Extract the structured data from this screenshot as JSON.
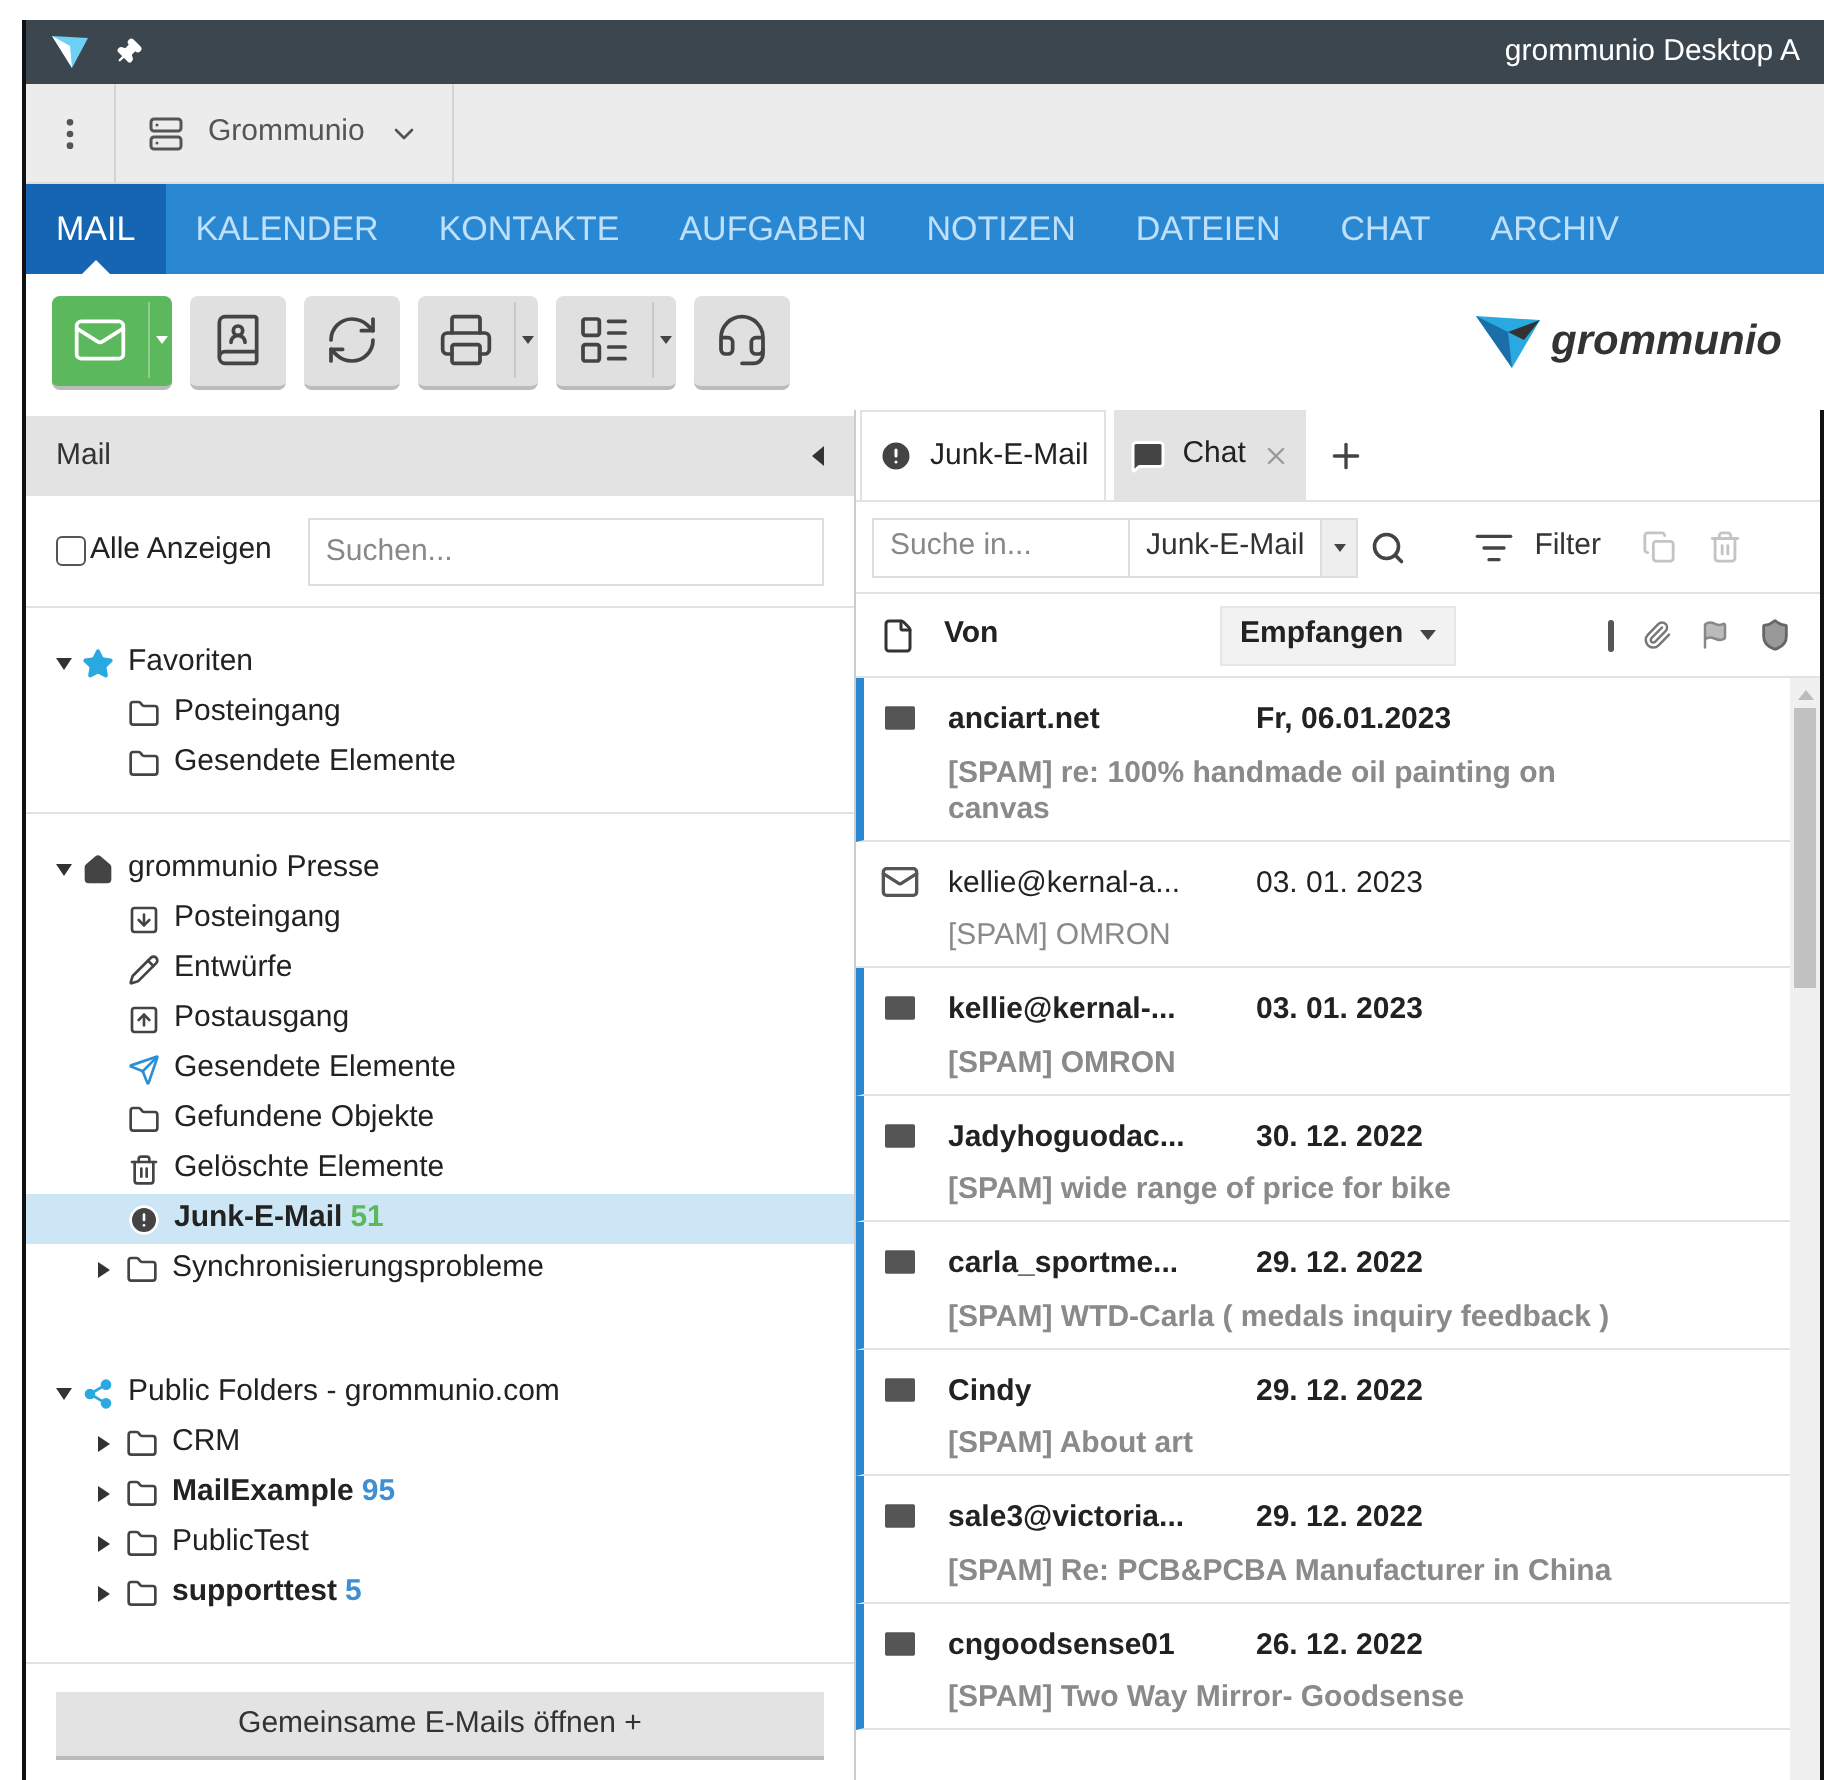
{
  "window": {
    "title": "grommunio Desktop A"
  },
  "account_bar": {
    "account": "Grommunio"
  },
  "nav_tabs": [
    {
      "label": "MAIL",
      "selected": true
    },
    {
      "label": "KALENDER",
      "selected": false
    },
    {
      "label": "KONTAKTE",
      "selected": false
    },
    {
      "label": "AUFGABEN",
      "selected": false
    },
    {
      "label": "NOTIZEN",
      "selected": false
    },
    {
      "label": "DATEIEN",
      "selected": false
    },
    {
      "label": "CHAT",
      "selected": false
    },
    {
      "label": "ARCHIV",
      "selected": false
    }
  ],
  "toolbar": {
    "buttons": [
      {
        "kind": "new-mail",
        "menu": true
      },
      {
        "kind": "contacts",
        "menu": false
      },
      {
        "kind": "sync",
        "menu": false
      },
      {
        "kind": "print",
        "menu": true
      },
      {
        "kind": "layout",
        "menu": true
      },
      {
        "kind": "support",
        "menu": false
      }
    ],
    "logo": "grommunio"
  },
  "sidebar": {
    "title": "Mail",
    "show_all": {
      "label": "Alle Anzeigen",
      "checked": false
    },
    "search": {
      "placeholder": "Suchen..."
    },
    "groups": [
      {
        "label": "Favoriten",
        "kind": "star",
        "expanded": true,
        "children": [
          {
            "label": "Posteingang",
            "kind": "folder",
            "expandable": false,
            "unread": false,
            "selected": false
          },
          {
            "label": "Gesendete Elemente",
            "kind": "folder",
            "expandable": false,
            "unread": false,
            "selected": false
          }
        ]
      },
      {
        "label": "grommunio Presse",
        "kind": "home",
        "expanded": true,
        "children": [
          {
            "label": "Posteingang",
            "kind": "inbox",
            "expandable": false,
            "unread": false,
            "selected": false
          },
          {
            "label": "Entwürfe",
            "kind": "drafts",
            "expandable": false,
            "unread": false,
            "selected": false
          },
          {
            "label": "Postausgang",
            "kind": "outbox",
            "expandable": false,
            "unread": false,
            "selected": false
          },
          {
            "label": "Gesendete Elemente",
            "kind": "sent",
            "expandable": false,
            "unread": false,
            "selected": false
          },
          {
            "label": "Gefundene Objekte",
            "kind": "folder",
            "expandable": false,
            "unread": false,
            "selected": false
          },
          {
            "label": "Gelöschte Elemente",
            "kind": "trash",
            "expandable": false,
            "unread": false,
            "selected": false
          },
          {
            "label": "Junk-E-Mail",
            "kind": "junk",
            "expandable": false,
            "unread": true,
            "selected": true,
            "count": "51",
            "color": "#5cb85c"
          },
          {
            "label": "Synchronisierungsprobleme",
            "kind": "folder",
            "expandable": true,
            "unread": false,
            "selected": false
          }
        ]
      },
      {
        "label": "Public Folders - grommunio.com",
        "kind": "share",
        "expanded": true,
        "children": [
          {
            "label": "CRM",
            "kind": "folder",
            "expandable": true,
            "unread": false,
            "selected": false
          },
          {
            "label": "MailExample",
            "kind": "folder",
            "expandable": true,
            "unread": true,
            "selected": false,
            "count": "95",
            "color": "#3f8fd2"
          },
          {
            "label": "PublicTest",
            "kind": "folder",
            "expandable": true,
            "unread": false,
            "selected": false
          },
          {
            "label": "supporttest",
            "kind": "folder",
            "expandable": true,
            "unread": true,
            "selected": false,
            "count": "5",
            "color": "#3f8fd2"
          }
        ]
      }
    ],
    "shared_button": "Gemeinsame E-Mails öffnen +"
  },
  "mail_pane": {
    "tabs": [
      {
        "label": "Junk-E-Mail",
        "kind": "junk",
        "selected": true,
        "closable": false
      },
      {
        "label": "Chat",
        "kind": "chat",
        "selected": false,
        "closable": true
      }
    ],
    "search": {
      "placeholder": "Suche in...",
      "scope": "Junk-E-Mail"
    },
    "filter": "Filter",
    "columns": {
      "from": "Von",
      "received": "Empfangen"
    },
    "messages": [
      {
        "from": "anciart.net",
        "date": "Fr, 06.01.2023",
        "subject": "[SPAM] re: 100% handmade oil painting on canvas",
        "unread": true
      },
      {
        "from": "kellie@kernal-a...",
        "date": "03. 01. 2023",
        "subject": "[SPAM] OMRON",
        "unread": false
      },
      {
        "from": "kellie@kernal-...",
        "date": "03. 01. 2023",
        "subject": "[SPAM] OMRON",
        "unread": true
      },
      {
        "from": "Jadyhoguodac...",
        "date": "30. 12. 2022",
        "subject": "[SPAM] wide range of price for bike",
        "unread": true
      },
      {
        "from": "carla_sportme...",
        "date": "29. 12. 2022",
        "subject": "[SPAM] WTD-Carla ( medals inquiry feedback )",
        "unread": true
      },
      {
        "from": "Cindy",
        "date": "29. 12. 2022",
        "subject": "[SPAM] About art",
        "unread": true
      },
      {
        "from": "sale3@victoria...",
        "date": "29. 12. 2022",
        "subject": "[SPAM] Re: PCB&PCBA Manufacturer in China",
        "unread": true
      },
      {
        "from": "cngoodsense01",
        "date": "26. 12. 2022",
        "subject": "[SPAM] Two Way Mirror- Goodsense",
        "unread": true
      }
    ]
  }
}
